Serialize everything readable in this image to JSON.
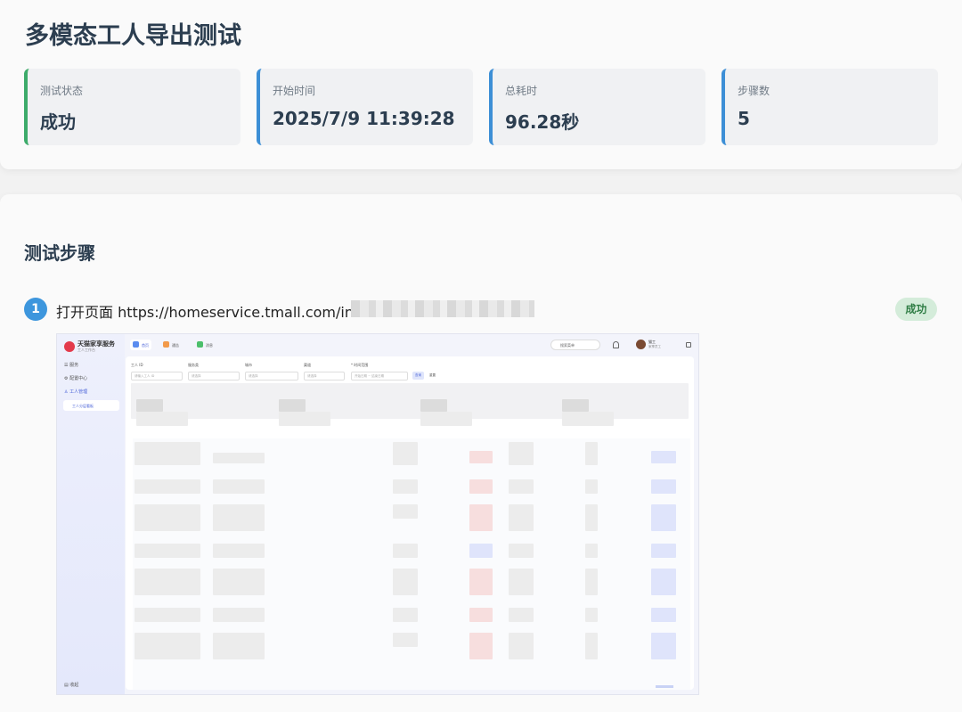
{
  "page_title": "多模态工人导出测试",
  "stats": [
    {
      "label": "测试状态",
      "value": "成功",
      "accent": "#3dab6a"
    },
    {
      "label": "开始时间",
      "value": "2025/7/9 11:39:28",
      "accent": "#3d8fd6"
    },
    {
      "label": "总耗时",
      "value": "96.28秒",
      "accent": "#3d8fd6"
    },
    {
      "label": "步骤数",
      "value": "5",
      "accent": "#3d8fd6"
    }
  ],
  "steps_section": {
    "title": "测试步骤",
    "steps": [
      {
        "number": "1",
        "description": "打开页面 https://homeservice.tmall.com/indu",
        "status": "成功",
        "status_color": "#2f7d45",
        "screenshot": {
          "app_name": "天猫家享服务",
          "app_subtitle": "工人工作台",
          "nav": [
            "服务",
            "配置中心",
            "工人管理"
          ],
          "nav_sub": "工人分层看板",
          "nav_bottom": "收起",
          "tabs": [
            "首页",
            "通告",
            "消息"
          ],
          "search_placeholder": "搜索菜单",
          "user_name": "猫工",
          "user_sub": "家享员工",
          "filters": [
            "工人 ID",
            "服务类",
            "城市",
            "渠道",
            "* 时间范围"
          ],
          "filter_placeholders": [
            "请输入工人 ID",
            "请选择",
            "请选择",
            "请选择",
            "开始日期 ~ 结束日期"
          ],
          "buttons": [
            "查询",
            "重置"
          ]
        }
      }
    ]
  }
}
